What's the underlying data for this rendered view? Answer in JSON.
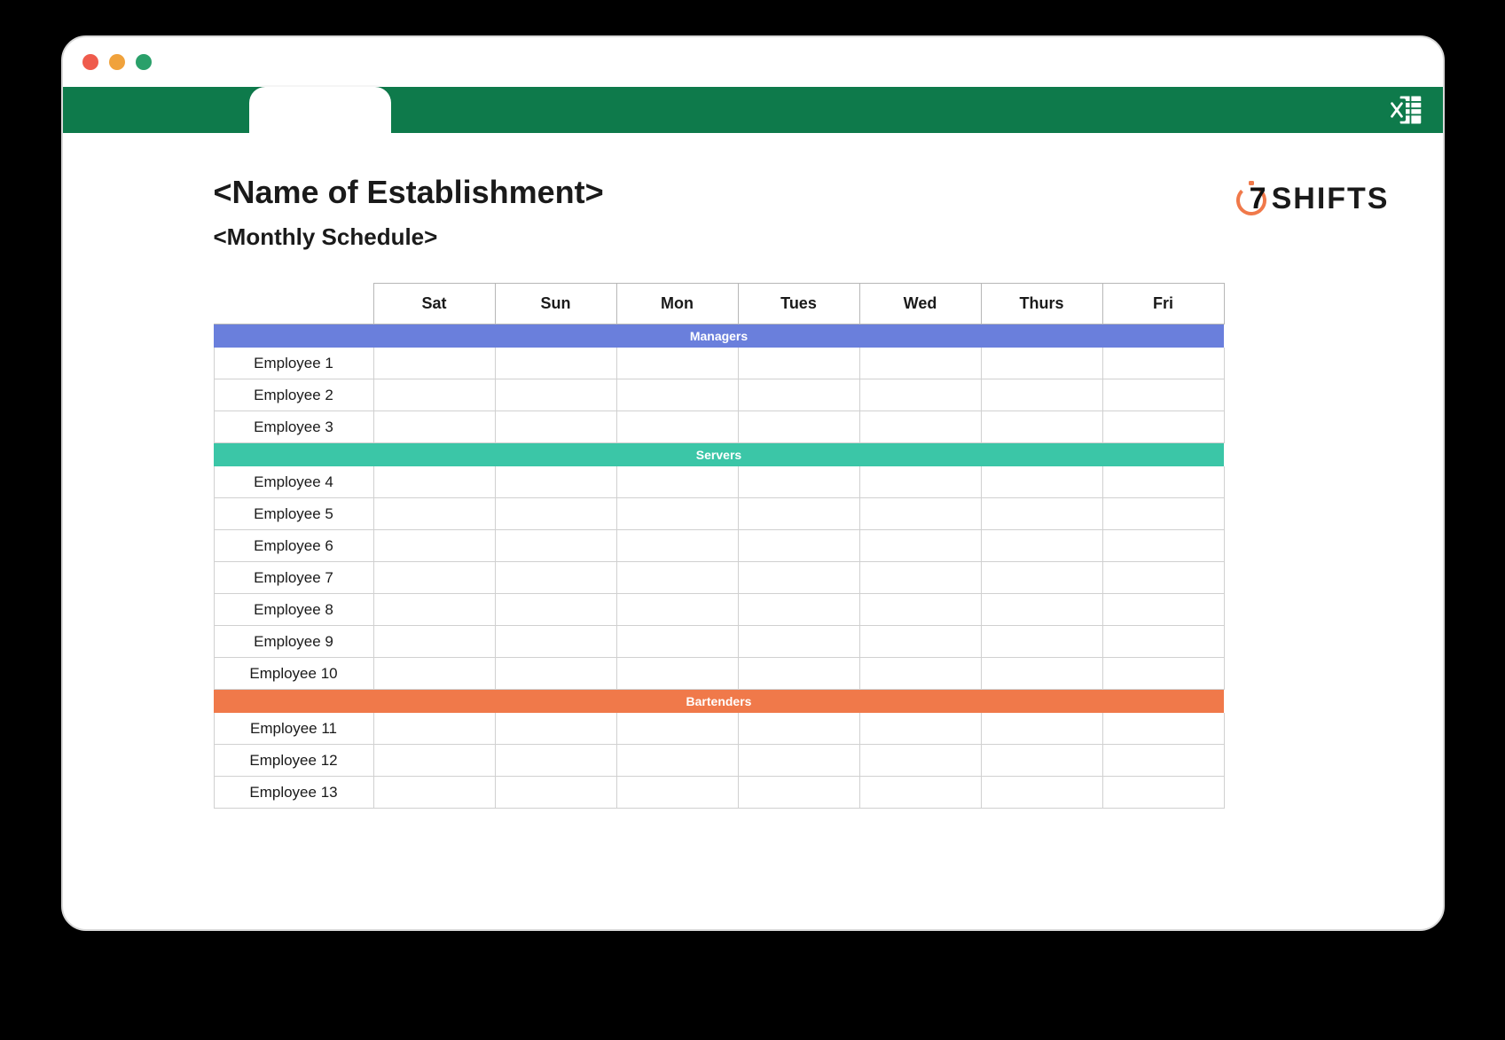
{
  "window": {
    "traffic_lights": [
      "red",
      "amber",
      "green"
    ]
  },
  "header": {
    "title": "<Name of Establishment>",
    "subtitle": "<Monthly Schedule>"
  },
  "brand": {
    "name": "7SHIFTS",
    "accent_color": "#f0794a",
    "seven": "7",
    "word": "SHIFTS"
  },
  "icons": {
    "excel_label": "Excel"
  },
  "colors": {
    "ribbon": "#0e7a4b",
    "managers": "#6a7fdc",
    "servers": "#3bc6a7",
    "bartenders": "#f0794a"
  },
  "schedule": {
    "day_headers": [
      "Sat",
      "Sun",
      "Mon",
      "Tues",
      "Wed",
      "Thurs",
      "Fri"
    ],
    "sections": [
      {
        "id": "managers",
        "label": "Managers",
        "employees": [
          "Employee 1",
          "Employee 2",
          "Employee 3"
        ]
      },
      {
        "id": "servers",
        "label": "Servers",
        "employees": [
          "Employee 4",
          "Employee 5",
          "Employee 6",
          "Employee 7",
          "Employee 8",
          "Employee 9",
          "Employee 10"
        ]
      },
      {
        "id": "bartenders",
        "label": "Bartenders",
        "employees": [
          "Employee 11",
          "Employee 12",
          "Employee 13"
        ]
      }
    ]
  }
}
